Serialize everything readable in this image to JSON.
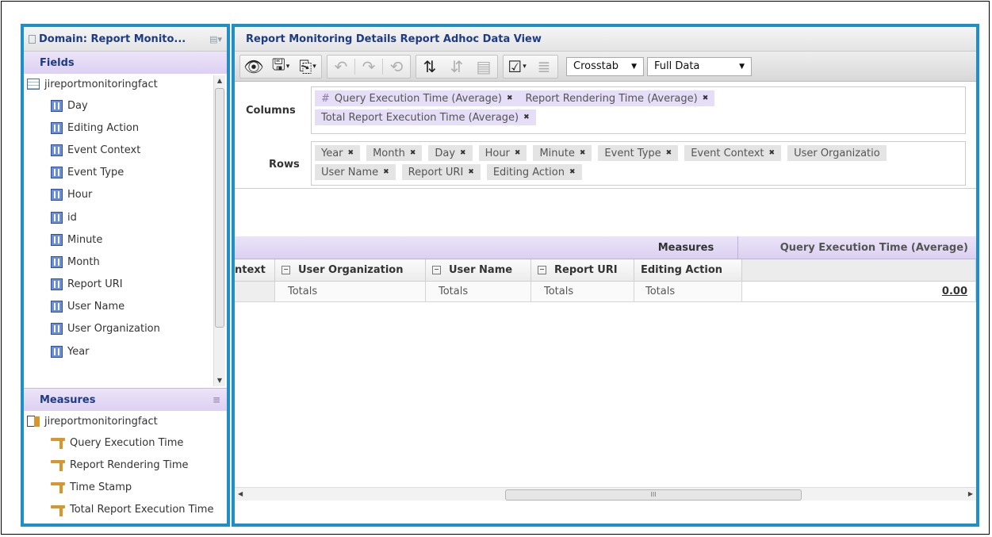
{
  "left_panel": {
    "domain_title": "Domain: Report Monito...",
    "fields_title": "Fields",
    "fields_root": "jireportmonitoringfact",
    "fields": [
      "Day",
      "Editing Action",
      "Event Context",
      "Event Type",
      "Hour",
      "id",
      "Minute",
      "Month",
      "Report URI",
      "User Name",
      "User Organization",
      "Year"
    ],
    "measures_title": "Measures",
    "measures_root": "jireportmonitoringfact",
    "measures": [
      "Query Execution Time",
      "Report Rendering Time",
      "Time Stamp",
      "Total Report Execution Time"
    ]
  },
  "view": {
    "title": "Report Monitoring Details Report Adhoc Data View",
    "toolbar": {
      "icons": [
        "eye-icon",
        "save-icon",
        "export-icon",
        "undo-icon",
        "redo-icon",
        "undo-all-icon",
        "switch-icon",
        "sort-icon",
        "options-icon",
        "select-icon",
        "query-icon"
      ],
      "view_type": "Crosstab",
      "data_mode": "Full Data"
    },
    "columns_label": "Columns",
    "rows_label": "Rows",
    "column_hash": "#",
    "columns_chips": [
      "Query Execution Time (Average)",
      "Report Rendering Time (Average)",
      "Total Report Execution Time (Average)"
    ],
    "rows_chips_line1": [
      "Year",
      "Month",
      "Day",
      "Hour",
      "Minute",
      "Event Type",
      "Event Context",
      "User Organizatio"
    ],
    "rows_chips_line2": [
      "User Name",
      "Report URI",
      "Editing Action"
    ],
    "remove_glyph": "✖"
  },
  "grid": {
    "measures_label": "Measures",
    "measure_col": "Query Execution Time (Average)",
    "collapse_glyph": "−",
    "row_headers": [
      "ntext",
      "User Organization",
      "User Name",
      "Report URI",
      "Editing Action"
    ],
    "totals_label": "Totals",
    "total_value": "0.00"
  },
  "scroll": {
    "up": "▲",
    "down": "▼",
    "left": "◀",
    "right": "▶",
    "grip": "III"
  },
  "accent": "#1f8fc7"
}
